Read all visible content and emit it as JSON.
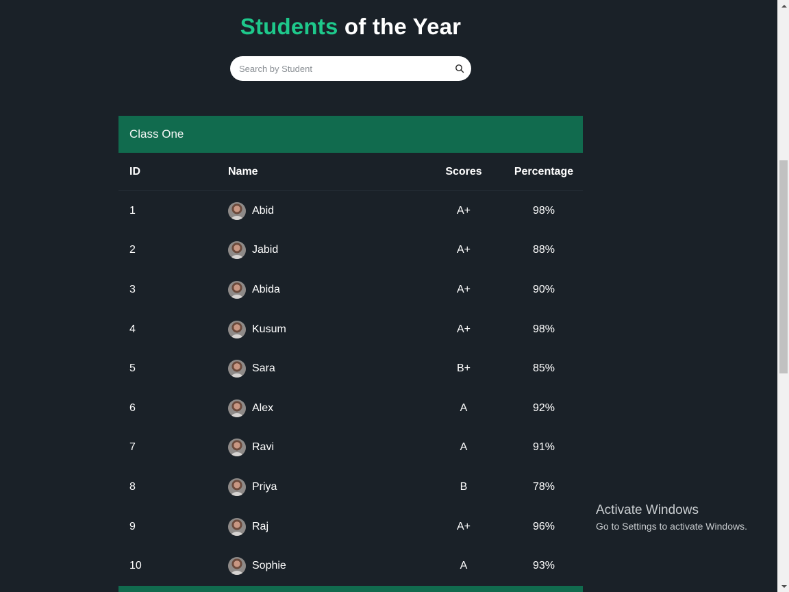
{
  "title": {
    "accent": "Students",
    "rest": " of the Year"
  },
  "search": {
    "placeholder": "Search by Student",
    "icon": "search-icon"
  },
  "table": {
    "class_name": "Class One",
    "columns": [
      "ID",
      "Name",
      "Scores",
      "Percentage"
    ],
    "rows": [
      {
        "id": "1",
        "name": "Abid",
        "score": "A+",
        "percentage": "98%"
      },
      {
        "id": "2",
        "name": "Jabid",
        "score": "A+",
        "percentage": "88%"
      },
      {
        "id": "3",
        "name": "Abida",
        "score": "A+",
        "percentage": "90%"
      },
      {
        "id": "4",
        "name": "Kusum",
        "score": "A+",
        "percentage": "98%"
      },
      {
        "id": "5",
        "name": "Sara",
        "score": "B+",
        "percentage": "85%"
      },
      {
        "id": "6",
        "name": "Alex",
        "score": "A",
        "percentage": "92%"
      },
      {
        "id": "7",
        "name": "Ravi",
        "score": "A",
        "percentage": "91%"
      },
      {
        "id": "8",
        "name": "Priya",
        "score": "B",
        "percentage": "78%"
      },
      {
        "id": "9",
        "name": "Raj",
        "score": "A+",
        "percentage": "96%"
      },
      {
        "id": "10",
        "name": "Sophie",
        "score": "A",
        "percentage": "93%"
      }
    ]
  },
  "watermark": {
    "line1": "Activate Windows",
    "line2": "Go to Settings to activate Windows."
  },
  "colors": {
    "background": "#1a2128",
    "accent": "#1ec88b",
    "header_band": "#116b4e"
  }
}
